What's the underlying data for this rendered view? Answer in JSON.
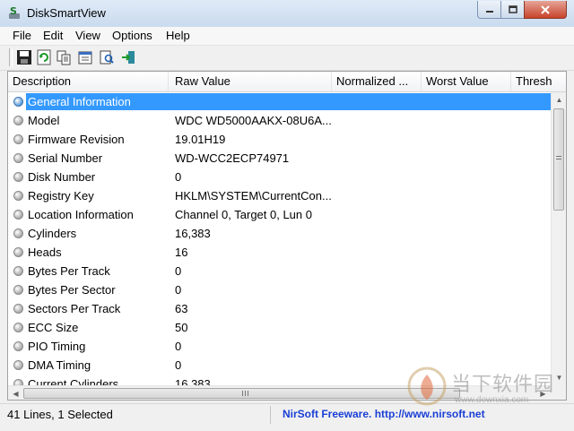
{
  "window": {
    "title": "DiskSmartView"
  },
  "menu": [
    "File",
    "Edit",
    "View",
    "Options",
    "Help"
  ],
  "toolbar": [
    {
      "name": "save-icon"
    },
    {
      "name": "refresh-icon"
    },
    {
      "name": "copy-icon"
    },
    {
      "name": "properties-icon"
    },
    {
      "name": "find-icon"
    },
    {
      "name": "exit-icon"
    }
  ],
  "columns": [
    "Description",
    "Raw Value",
    "Normalized ...",
    "Worst Value",
    "Thresh"
  ],
  "rows": [
    {
      "desc": "General Information",
      "raw": "",
      "selected": true,
      "color": "#5b9bd5"
    },
    {
      "desc": "Model",
      "raw": "WDC WD5000AAKX-08U6A...",
      "color": "#a8a8a8"
    },
    {
      "desc": "Firmware Revision",
      "raw": "19.01H19",
      "color": "#a8a8a8"
    },
    {
      "desc": "Serial Number",
      "raw": "WD-WCC2ECP74971",
      "color": "#a8a8a8"
    },
    {
      "desc": "Disk Number",
      "raw": "0",
      "color": "#a8a8a8"
    },
    {
      "desc": "Registry Key",
      "raw": "HKLM\\SYSTEM\\CurrentCon...",
      "color": "#a8a8a8"
    },
    {
      "desc": "Location Information",
      "raw": "Channel 0, Target 0, Lun 0",
      "color": "#a8a8a8"
    },
    {
      "desc": "Cylinders",
      "raw": "16,383",
      "color": "#a8a8a8"
    },
    {
      "desc": "Heads",
      "raw": "16",
      "color": "#a8a8a8"
    },
    {
      "desc": "Bytes Per Track",
      "raw": "0",
      "color": "#a8a8a8"
    },
    {
      "desc": "Bytes Per Sector",
      "raw": "0",
      "color": "#a8a8a8"
    },
    {
      "desc": "Sectors Per Track",
      "raw": "63",
      "color": "#a8a8a8"
    },
    {
      "desc": "ECC Size",
      "raw": "50",
      "color": "#a8a8a8"
    },
    {
      "desc": "PIO Timing",
      "raw": "0",
      "color": "#a8a8a8"
    },
    {
      "desc": "DMA Timing",
      "raw": "0",
      "color": "#a8a8a8"
    },
    {
      "desc": "Current Cylinders",
      "raw": "16,383",
      "color": "#a8a8a8"
    }
  ],
  "status": {
    "lines": "41 Lines, 1 Selected",
    "link": "NirSoft Freeware.  http://www.nirsoft.net"
  },
  "watermark": {
    "text": "当下软件园",
    "url": "www.downxia.com"
  }
}
